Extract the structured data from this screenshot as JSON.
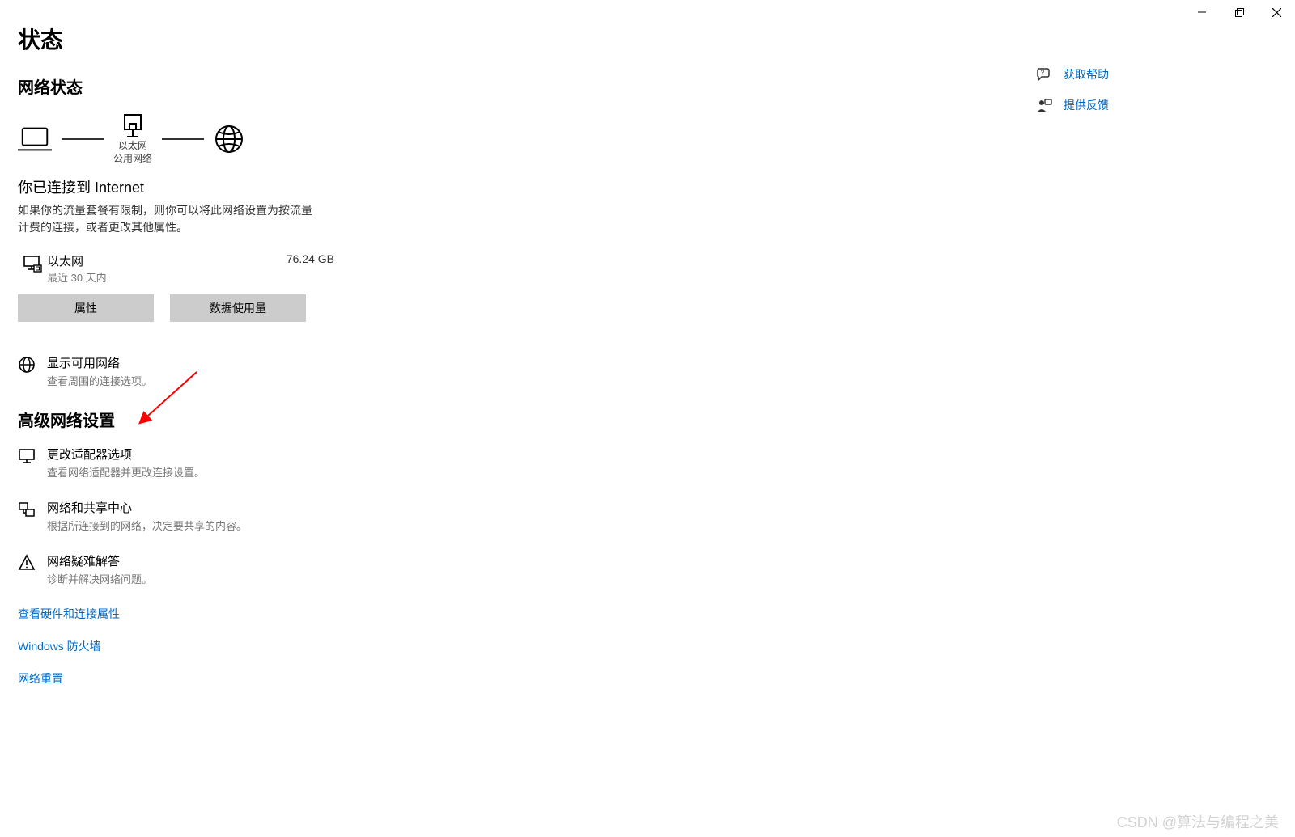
{
  "window": {
    "title": "状态"
  },
  "sections": {
    "network_status": "网络状态",
    "advanced": "高级网络设置"
  },
  "diagram": {
    "ethernet_label": "以太网",
    "public_net_label": "公用网络"
  },
  "connected": {
    "heading": "你已连接到 Internet",
    "description": "如果你的流量套餐有限制，则你可以将此网络设置为按流量计费的连接，或者更改其他属性。"
  },
  "ethernet_row": {
    "name": "以太网",
    "sub": "最近 30 天内",
    "usage": "76.24 GB"
  },
  "buttons": {
    "properties": "属性",
    "data_usage": "数据使用量"
  },
  "items": {
    "show_networks": {
      "title": "显示可用网络",
      "sub": "查看周围的连接选项。"
    },
    "adapter_options": {
      "title": "更改适配器选项",
      "sub": "查看网络适配器并更改连接设置。"
    },
    "sharing_center": {
      "title": "网络和共享中心",
      "sub": "根据所连接到的网络，决定要共享的内容。"
    },
    "troubleshoot": {
      "title": "网络疑难解答",
      "sub": "诊断并解决网络问题。"
    }
  },
  "links": {
    "hw_props": "查看硬件和连接属性",
    "firewall": "Windows 防火墙",
    "reset": "网络重置"
  },
  "aside": {
    "help": "获取帮助",
    "feedback": "提供反馈"
  },
  "watermark": "CSDN @算法与编程之美"
}
